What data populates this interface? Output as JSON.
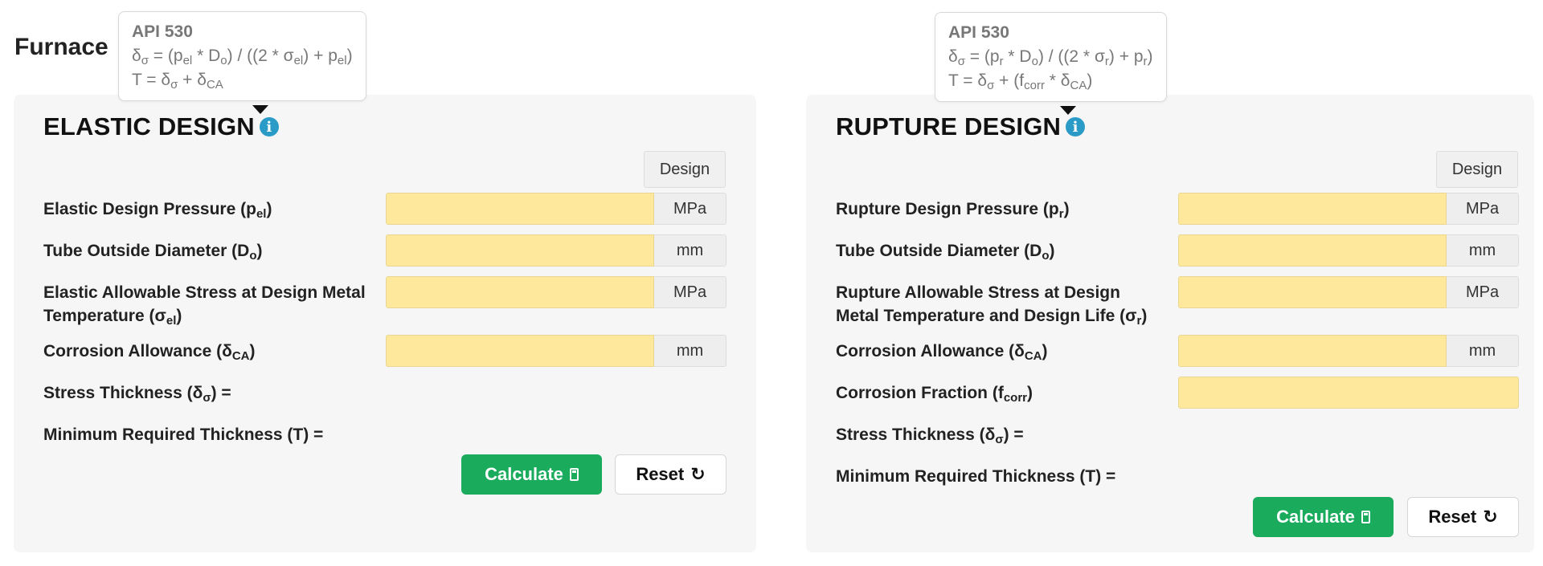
{
  "page": {
    "title": "Furnace"
  },
  "left": {
    "tooltip": {
      "title": "API 530",
      "line1": [
        "δ",
        "σ",
        " = (p",
        "el",
        " * D",
        "o",
        ") / ((2 * σ",
        "el",
        ") + p",
        "el",
        ")"
      ],
      "line2": [
        "T = δ",
        "σ",
        " + δ",
        "CA",
        "",
        "",
        "",
        "",
        "",
        "",
        ""
      ]
    },
    "heading": "ELASTIC DESIGN",
    "column_header": "Design",
    "rows": [
      {
        "label_pre": "Elastic Design Pressure (p",
        "label_sub": "el",
        "label_post": ")",
        "unit": "MPa",
        "value": ""
      },
      {
        "label_pre": "Tube Outside Diameter (D",
        "label_sub": "o",
        "label_post": ")",
        "unit": "mm",
        "value": ""
      },
      {
        "label_pre": "Elastic Allowable Stress at Design Metal",
        "label_line2_pre": "Temperature (σ",
        "label_sub": "el",
        "label_post": ")",
        "unit": "MPa",
        "value": ""
      },
      {
        "label_pre": "Corrosion Allowance (δ",
        "label_sub": "CA",
        "label_post": ")",
        "unit": "mm",
        "value": ""
      }
    ],
    "results": [
      {
        "label_pre": "Stress Thickness (δ",
        "label_sub": "σ",
        "label_post": ") ="
      },
      {
        "label_pre": "Minimum Required Thickness (T) =",
        "label_sub": "",
        "label_post": ""
      }
    ],
    "buttons": {
      "calculate": "Calculate",
      "reset": "Reset"
    }
  },
  "right": {
    "tooltip": {
      "title": "API 530",
      "line1": [
        "δ",
        "σ",
        " = (p",
        "r",
        " * D",
        "o",
        ") / ((2 * σ",
        "r",
        ") + p",
        "r",
        ")"
      ],
      "line2": [
        "T = δ",
        "σ",
        " + (f",
        "corr",
        " * δ",
        "CA",
        ")",
        "",
        "",
        "",
        ""
      ]
    },
    "heading": "RUPTURE DESIGN",
    "column_header": "Design",
    "rows": [
      {
        "label_pre": "Rupture Design Pressure (p",
        "label_sub": "r",
        "label_post": ")",
        "unit": "MPa",
        "value": ""
      },
      {
        "label_pre": "Tube Outside Diameter (D",
        "label_sub": "o",
        "label_post": ")",
        "unit": "mm",
        "value": ""
      },
      {
        "label_pre": "Rupture Allowable Stress at Design",
        "label_line2_pre": "Metal Temperature and Design Life (σ",
        "label_sub": "r",
        "label_post": ")",
        "unit": "MPa",
        "value": ""
      },
      {
        "label_pre": "Corrosion Allowance (δ",
        "label_sub": "CA",
        "label_post": ")",
        "unit": "mm",
        "value": ""
      },
      {
        "label_pre": "Corrosion Fraction (f",
        "label_sub": "corr",
        "label_post": ")",
        "unit": "",
        "value": ""
      }
    ],
    "results": [
      {
        "label_pre": "Stress Thickness (δ",
        "label_sub": "σ",
        "label_post": ") ="
      },
      {
        "label_pre": "Minimum Required Thickness (T) =",
        "label_sub": "",
        "label_post": ""
      }
    ],
    "buttons": {
      "calculate": "Calculate",
      "reset": "Reset"
    }
  },
  "colors": {
    "input_background": "#fde89b",
    "calculate_button": "#1aab5d",
    "info_icon": "#2a9bc7",
    "panel_background": "#f6f6f6"
  },
  "icons": {
    "info": "info-icon",
    "calculator": "calculator-icon",
    "refresh": "refresh-icon"
  }
}
